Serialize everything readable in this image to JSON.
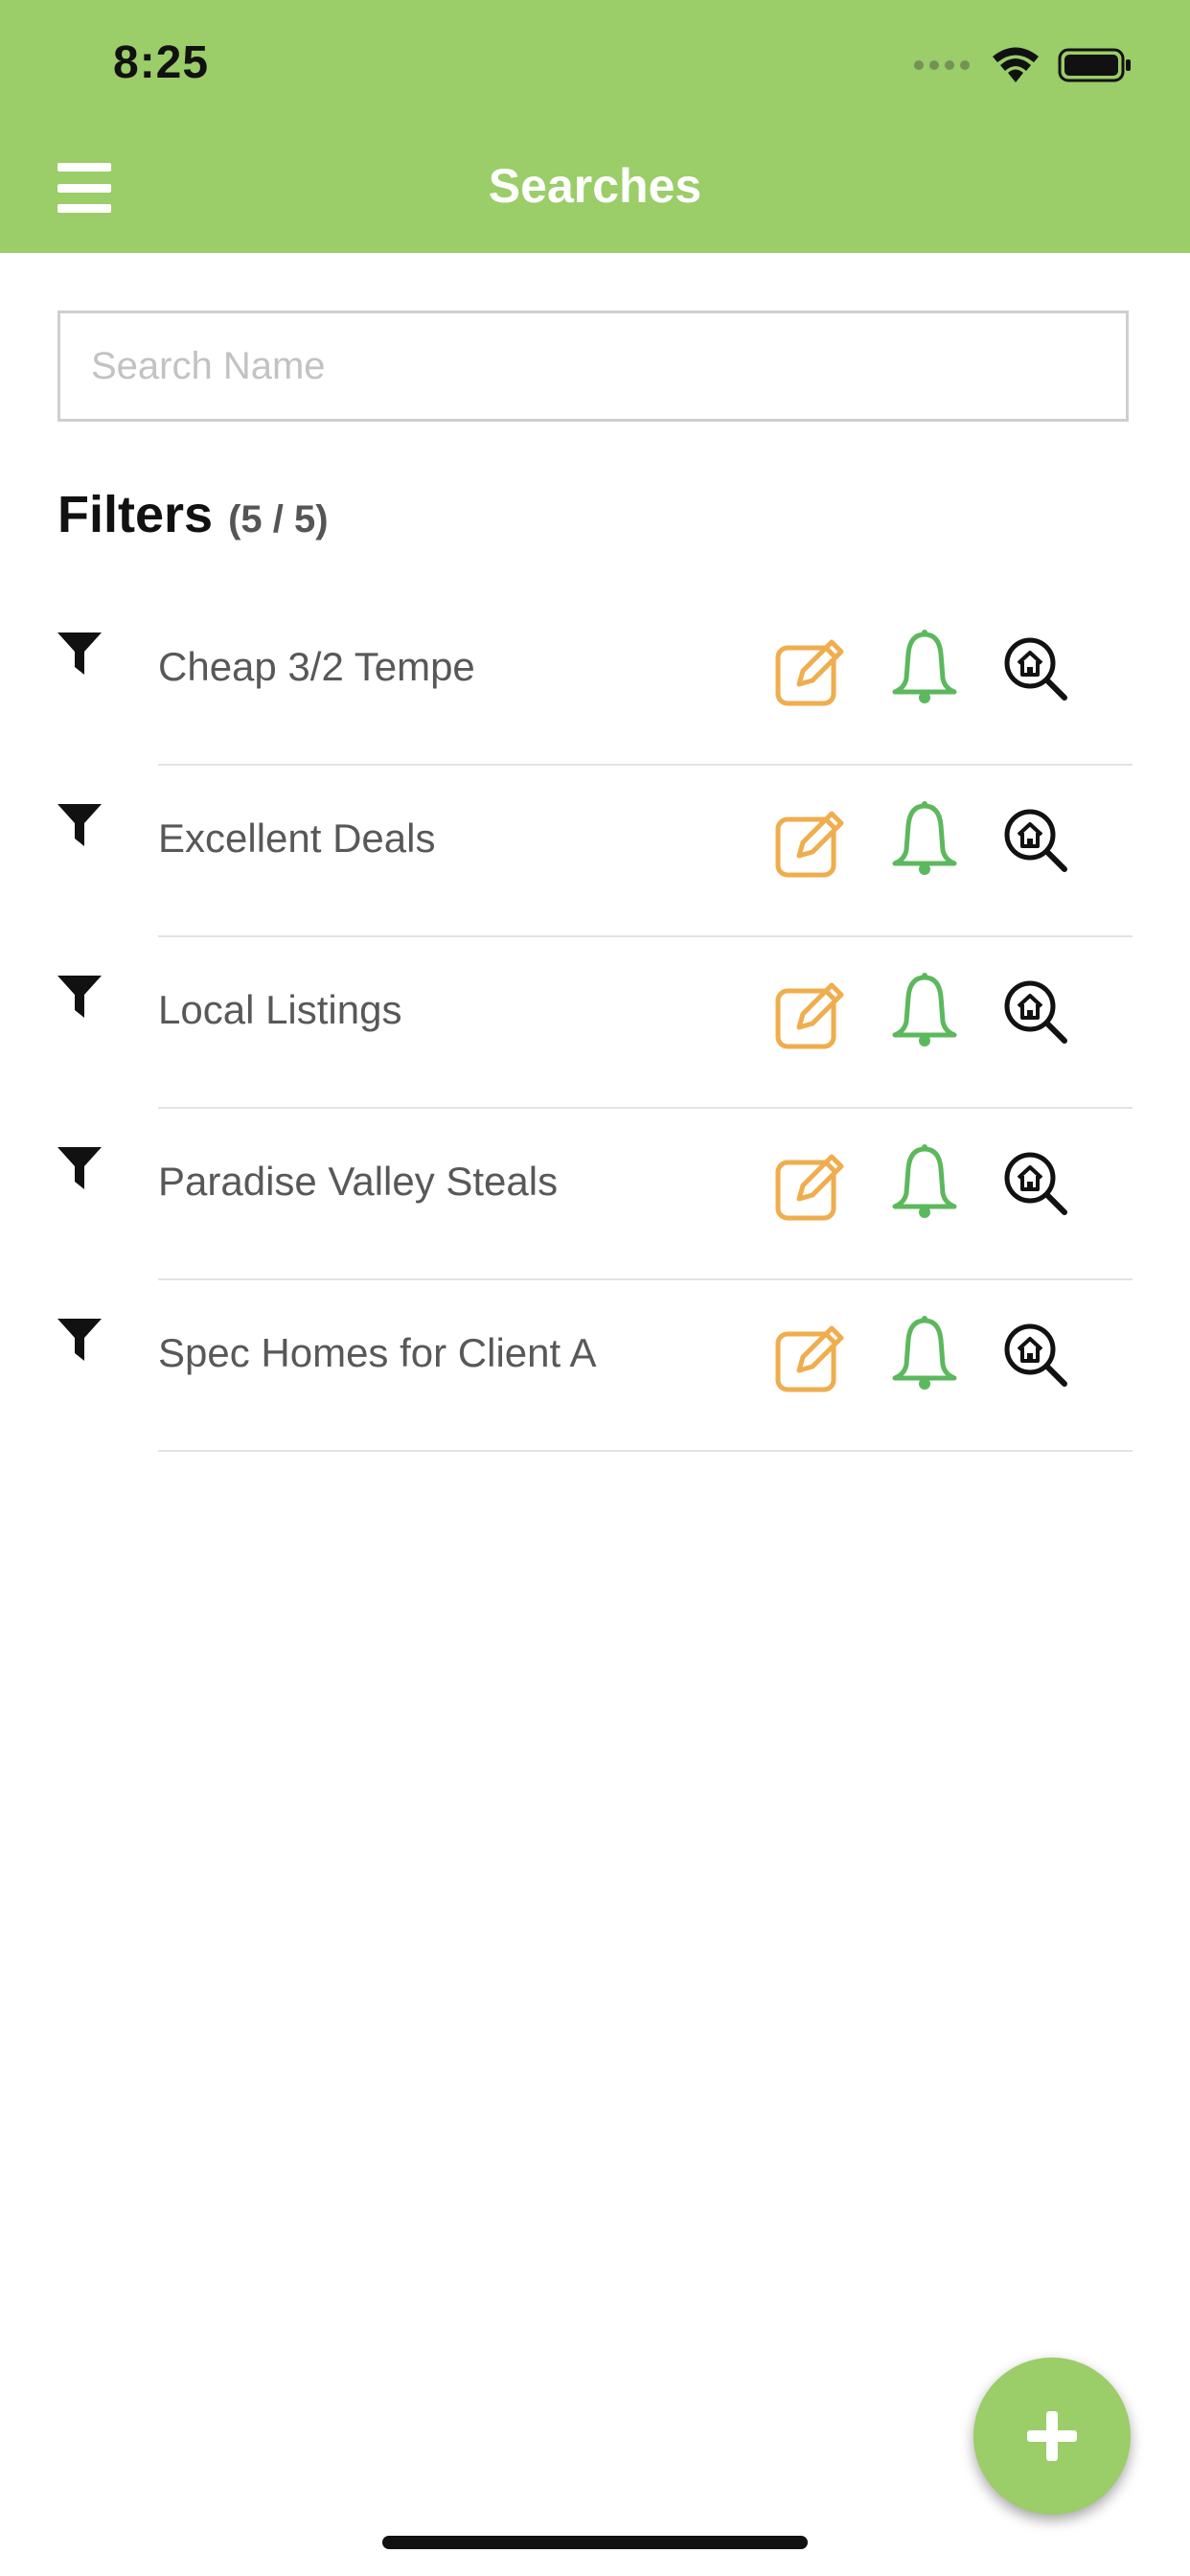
{
  "status_bar": {
    "time": "8:25",
    "icons": [
      "signal-dots-icon",
      "wifi-icon",
      "battery-icon"
    ]
  },
  "nav": {
    "title": "Searches",
    "menu_icon": "hamburger-menu-icon"
  },
  "search": {
    "placeholder": "Search Name",
    "value": ""
  },
  "filters": {
    "title": "Filters",
    "count": "(5 / 5)",
    "items": [
      {
        "label": "Cheap 3/2 Tempe"
      },
      {
        "label": "Excellent Deals"
      },
      {
        "label": "Local Listings"
      },
      {
        "label": "Paradise Valley Steals"
      },
      {
        "label": "Spec Homes for Client A"
      }
    ],
    "row_icons": [
      "filter-icon",
      "edit-icon",
      "bell-icon",
      "home-search-icon"
    ]
  },
  "fab": {
    "icon": "plus-icon"
  },
  "colors": {
    "brand": "#9bcd68",
    "edit": "#f0ad4e",
    "bell": "#5cb85c",
    "text": "#585858"
  }
}
